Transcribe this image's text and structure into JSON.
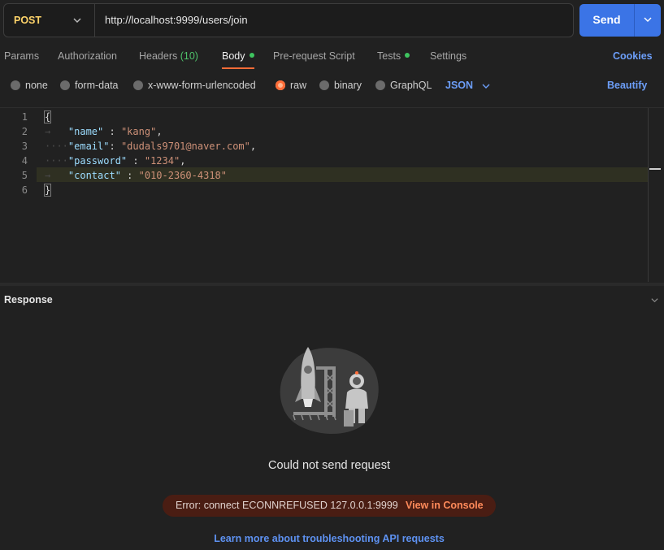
{
  "request": {
    "method": "POST",
    "url": "http://localhost:9999/users/join",
    "send_label": "Send"
  },
  "tabs": {
    "params": "Params",
    "authorization": "Authorization",
    "headers_label": "Headers",
    "headers_count": "(10)",
    "body": "Body",
    "pre_request": "Pre-request Script",
    "tests": "Tests",
    "settings": "Settings",
    "cookies": "Cookies"
  },
  "body_types": {
    "none": "none",
    "form_data": "form-data",
    "urlencoded": "x-www-form-urlencoded",
    "raw": "raw",
    "binary": "binary",
    "graphql": "GraphQL",
    "selected": "raw",
    "format": "JSON",
    "beautify": "Beautify"
  },
  "editor": {
    "line_numbers": [
      "1",
      "2",
      "3",
      "4",
      "5",
      "6"
    ],
    "open_brace": "{",
    "close_brace": "}",
    "fields": [
      {
        "key": "\"name\"",
        "sep": " : ",
        "value": "\"kang\"",
        "tail": ","
      },
      {
        "key": "\"email\"",
        "sep": ": ",
        "value": "\"dudals9701@naver.com\"",
        "tail": ","
      },
      {
        "key": "\"password\"",
        "sep": " : ",
        "value": "\"1234\"",
        "tail": ","
      },
      {
        "key": "\"contact\"",
        "sep": " : ",
        "value": "\"010-2360-4318\"",
        "tail": ""
      }
    ]
  },
  "response": {
    "title": "Response",
    "error_title": "Could not send request",
    "error_message": "Error: connect ECONNREFUSED 127.0.0.1:9999",
    "view_console": "View in Console",
    "learn_more": "Learn more about troubleshooting API requests"
  },
  "colors": {
    "accent": "#ff6c37",
    "send": "#3b74e6",
    "link": "#6c9ef8",
    "method": "#ffd46a",
    "error_bg": "#4a1d13"
  }
}
